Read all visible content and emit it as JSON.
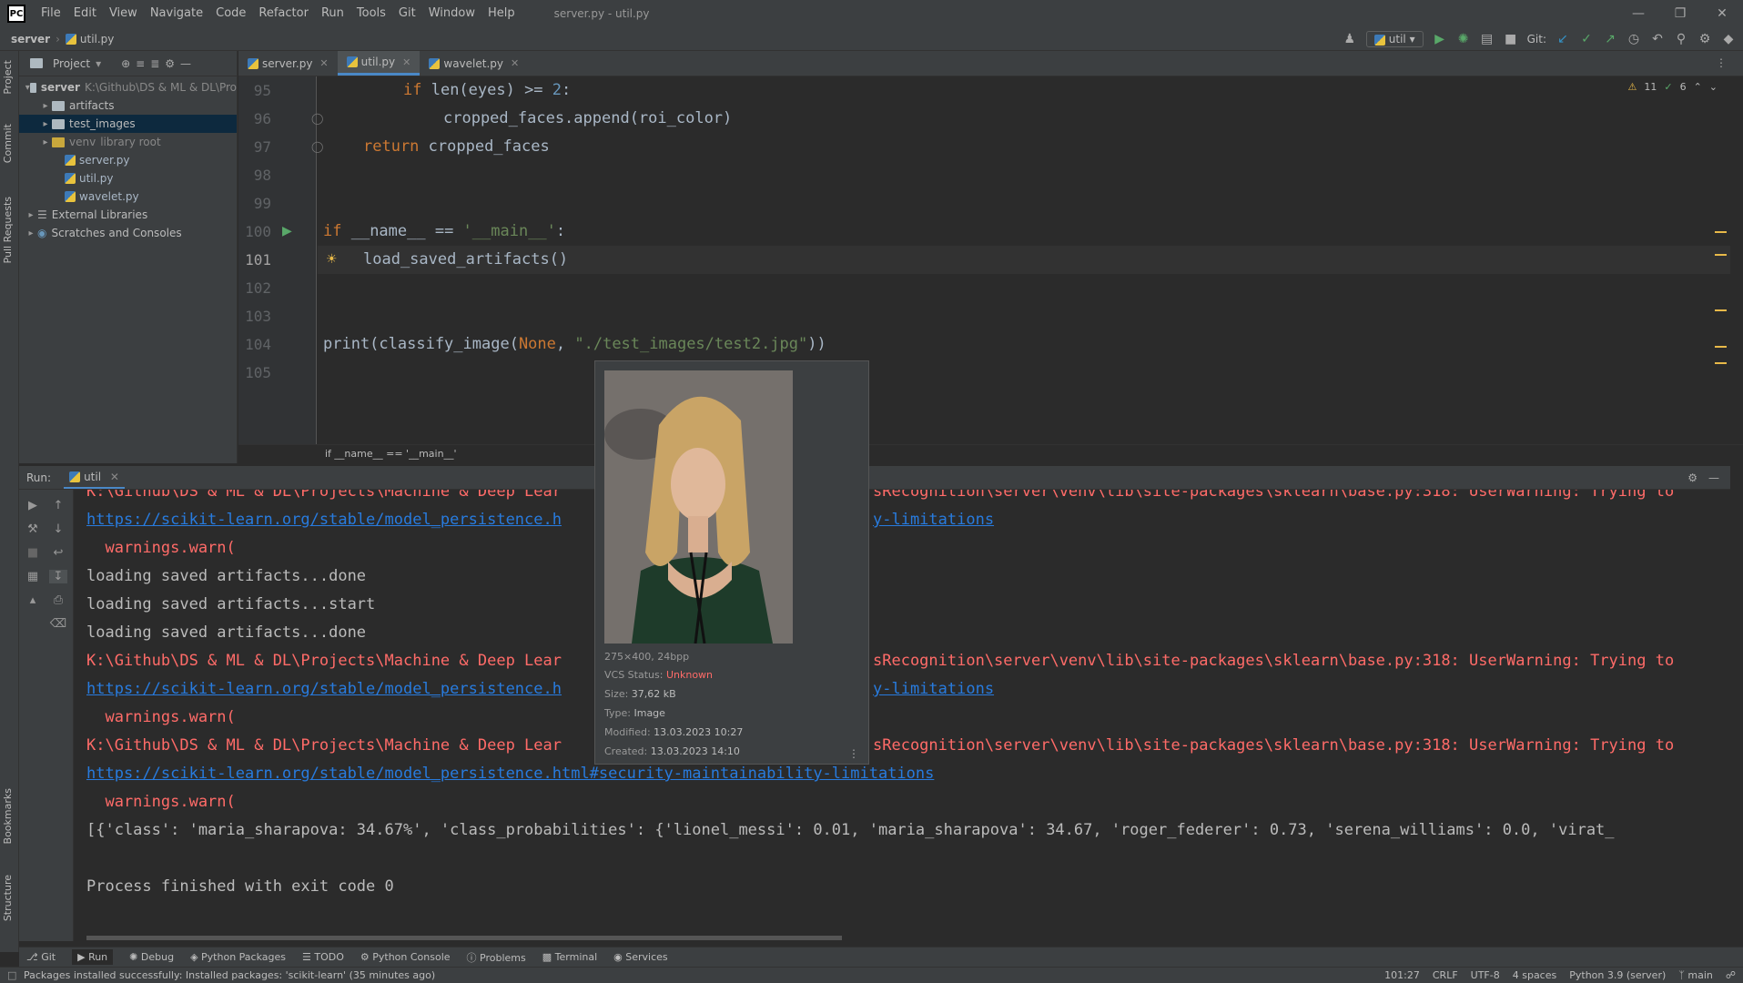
{
  "window": {
    "logo": "PC",
    "title": "server.py - util.py",
    "menu": [
      "File",
      "Edit",
      "View",
      "Navigate",
      "Code",
      "Refactor",
      "Run",
      "Tools",
      "Git",
      "Window",
      "Help"
    ]
  },
  "navbar": {
    "project": "server",
    "file": "util.py",
    "run_config": "util",
    "git_label": "Git:"
  },
  "project_panel": {
    "title": "Project",
    "root_name": "server",
    "root_path": "K:\\Github\\DS & ML & DL\\Pro",
    "items": [
      {
        "label": "artifacts",
        "note": ""
      },
      {
        "label": "test_images",
        "note": ""
      },
      {
        "label": "venv",
        "note": "library root"
      },
      {
        "label": "server.py",
        "note": ""
      },
      {
        "label": "util.py",
        "note": ""
      },
      {
        "label": "wavelet.py",
        "note": ""
      }
    ],
    "external": "External Libraries",
    "scratches": "Scratches and Consoles"
  },
  "left_strip": {
    "project": "Project",
    "commit": "Commit",
    "pull": "Pull Requests",
    "bookmarks": "Bookmarks",
    "structure": "Structure"
  },
  "editor": {
    "tabs": [
      "server.py",
      "util.py",
      "wavelet.py"
    ],
    "active_tab": "util.py",
    "inspection": {
      "warnings": "11",
      "ok": "6"
    },
    "lines": [
      {
        "n": "95"
      },
      {
        "n": "96"
      },
      {
        "n": "97"
      },
      {
        "n": "98"
      },
      {
        "n": "99"
      },
      {
        "n": "100"
      },
      {
        "n": "101"
      },
      {
        "n": "102"
      },
      {
        "n": "103"
      },
      {
        "n": "104"
      },
      {
        "n": "105"
      }
    ],
    "code": {
      "l95_kw": "if",
      "l95_a": " len(eyes) >= ",
      "l95_num": "2",
      "l95_b": ":",
      "l96": "cropped_faces.append(roi_color)",
      "l97_kw": "return",
      "l97_b": " cropped_faces",
      "l100_kw": "if",
      "l100_a": " __name__ == ",
      "l100_str": "'__main__'",
      "l100_b": ":",
      "l101": "load_saved_artifacts()",
      "l104_a": "print(classify_image(",
      "l104_kw": "None",
      "l104_b": ", ",
      "l104_str": "\"./test_images/test2.jpg\"",
      "l104_c": "))"
    },
    "breadcrumb": "if __name__ == '__main__'"
  },
  "run": {
    "label": "Run:",
    "tab": "util",
    "console": [
      {
        "type": "err",
        "text": "K:\\Github\\DS & ML & DL\\Projects\\Machine & Deep Lear"
      },
      {
        "type": "link",
        "text": "https://scikit-learn.org/stable/model_persistence.h"
      },
      {
        "type": "err",
        "text": "  warnings.warn("
      },
      {
        "type": "out",
        "text": "loading saved artifacts...done"
      },
      {
        "type": "out",
        "text": "loading saved artifacts...start"
      },
      {
        "type": "out",
        "text": "loading saved artifacts...done"
      },
      {
        "type": "err",
        "text": "K:\\Github\\DS & ML & DL\\Projects\\Machine & Deep Lear"
      },
      {
        "type": "link",
        "text": "https://scikit-learn.org/stable/model_persistence.h"
      },
      {
        "type": "err",
        "text": "  warnings.warn("
      },
      {
        "type": "err",
        "text": "K:\\Github\\DS & ML & DL\\Projects\\Machine & Deep Lear"
      },
      {
        "type": "link",
        "text": "https://scikit-learn.org/stable/model_persistence.html#security-maintainability-limitations"
      },
      {
        "type": "err",
        "text": "  warnings.warn("
      },
      {
        "type": "out",
        "text": "[{'class': 'maria_sharapova: 34.67%', 'class_probabilities': {'lionel_messi': 0.01, 'maria_sharapova': 34.67, 'roger_federer': 0.73, 'serena_williams': 0.0, 'virat_"
      },
      {
        "type": "out",
        "text": ""
      },
      {
        "type": "out",
        "text": "Process finished with exit code 0"
      }
    ],
    "right_err": "sRecognition\\server\\venv\\lib\\site-packages\\sklearn\\base.py:318: UserWarning: Trying to",
    "right_link": "y-limitations"
  },
  "popup": {
    "dims": "275×400, 24bpp",
    "vcs_label": "VCS Status:",
    "vcs_value": "Unknown",
    "size_label": "Size:",
    "size_value": "37,62 kB",
    "type_label": "Type:",
    "type_value": "Image",
    "modified_label": "Modified:",
    "modified_value": "13.03.2023 10:27",
    "created_label": "Created:",
    "created_value": "13.03.2023 14:10"
  },
  "bottom_tools": [
    "Git",
    "Run",
    "Debug",
    "Python Packages",
    "TODO",
    "Python Console",
    "Problems",
    "Terminal",
    "Services"
  ],
  "status": {
    "message": "Packages installed successfully: Installed packages: 'scikit-learn' (35 minutes ago)",
    "position": "101:27",
    "line_sep": "CRLF",
    "encoding": "UTF-8",
    "indent": "4 spaces",
    "interpreter": "Python 3.9 (server)",
    "branch": "main"
  },
  "colors": {
    "accent": "#4a88c7",
    "error": "#ff6b68",
    "link": "#287bde",
    "keyword": "#cc7832",
    "string": "#6a8759"
  }
}
